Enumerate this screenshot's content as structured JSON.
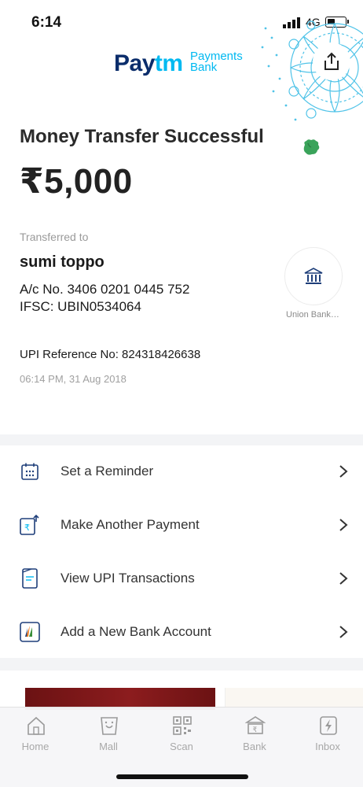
{
  "status_bar": {
    "time": "6:14",
    "network": "4G"
  },
  "header": {
    "logo_primary": "Pay",
    "logo_accent": "tm",
    "logo_sub_line1": "Payments",
    "logo_sub_line2": "Bank"
  },
  "transaction": {
    "title": "Money Transfer Successful",
    "amount": "₹5,000",
    "transferred_label": "Transferred to",
    "payee_name": "sumi toppo",
    "account_number": "A/c No. 3406 0201 0445 752",
    "ifsc": "IFSC: UBIN0534064",
    "bank_name": "Union Bank…",
    "upi_reference": "UPI Reference No: 824318426638",
    "timestamp": "06:14 PM, 31 Aug 2018"
  },
  "actions": [
    {
      "label": "Set a Reminder",
      "icon": "calendar-icon"
    },
    {
      "label": "Make Another Payment",
      "icon": "rupee-send-icon"
    },
    {
      "label": "View UPI Transactions",
      "icon": "passbook-icon"
    },
    {
      "label": "Add a New Bank Account",
      "icon": "bank-account-icon"
    }
  ],
  "bottom_nav": [
    {
      "label": "Home",
      "icon": "home-icon"
    },
    {
      "label": "Mall",
      "icon": "mall-icon"
    },
    {
      "label": "Scan",
      "icon": "scan-icon"
    },
    {
      "label": "Bank",
      "icon": "bank-icon"
    },
    {
      "label": "Inbox",
      "icon": "inbox-icon"
    }
  ],
  "colors": {
    "paytm_navy": "#0b2d6b",
    "paytm_blue": "#00b9f1",
    "success_green": "#3aa35a",
    "icon_navy": "#1f3f7a"
  }
}
